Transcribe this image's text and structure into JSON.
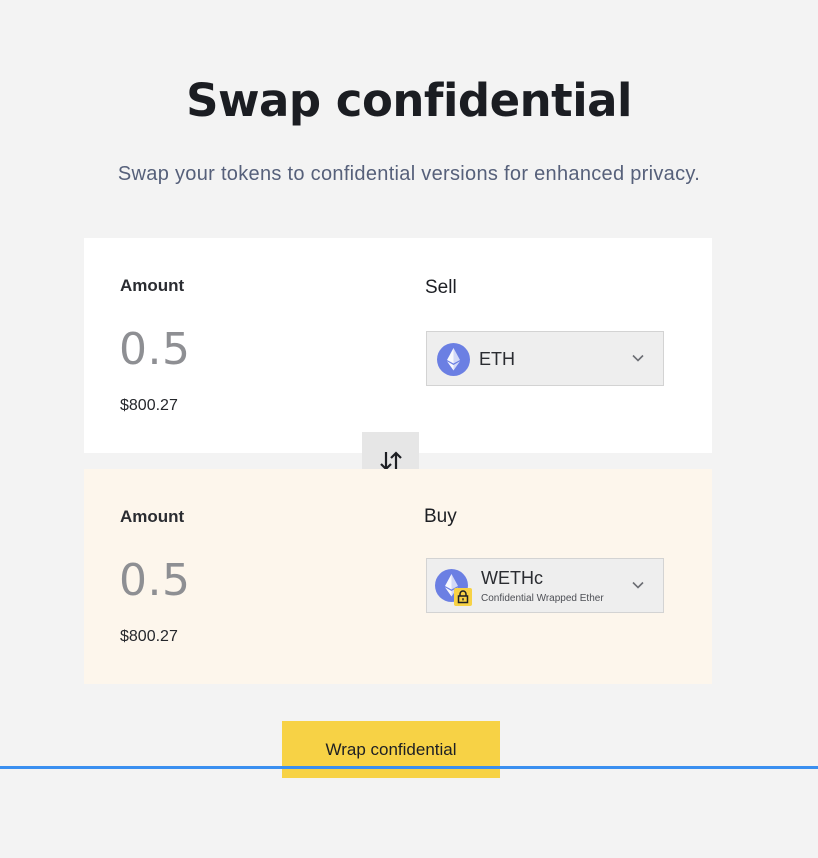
{
  "header": {
    "title": "Swap confidential",
    "subtitle": "Swap your tokens to confidential versions for enhanced privacy."
  },
  "sell": {
    "amount_label": "Amount",
    "amount_value": "0.5",
    "usd_value": "$800.27",
    "side_label": "Sell",
    "token": {
      "symbol": "ETH",
      "icon": "ethereum-icon",
      "icon_color": "#6b7fe3"
    }
  },
  "buy": {
    "amount_label": "Amount",
    "amount_value": "0.5",
    "usd_value": "$800.27",
    "side_label": "Buy",
    "token": {
      "symbol": "WETHc",
      "name": "Confidential Wrapped Ether",
      "icon": "ethereum-icon",
      "badge_icon": "lock-icon",
      "icon_color": "#6b7fe3"
    }
  },
  "swap_direction_icon": "swap-arrows-icon",
  "action": {
    "label": "Wrap confidential"
  },
  "colors": {
    "accent": "#f7d245",
    "buy_card_bg": "#fdf6ec",
    "guide_line": "#3a8ff0"
  }
}
